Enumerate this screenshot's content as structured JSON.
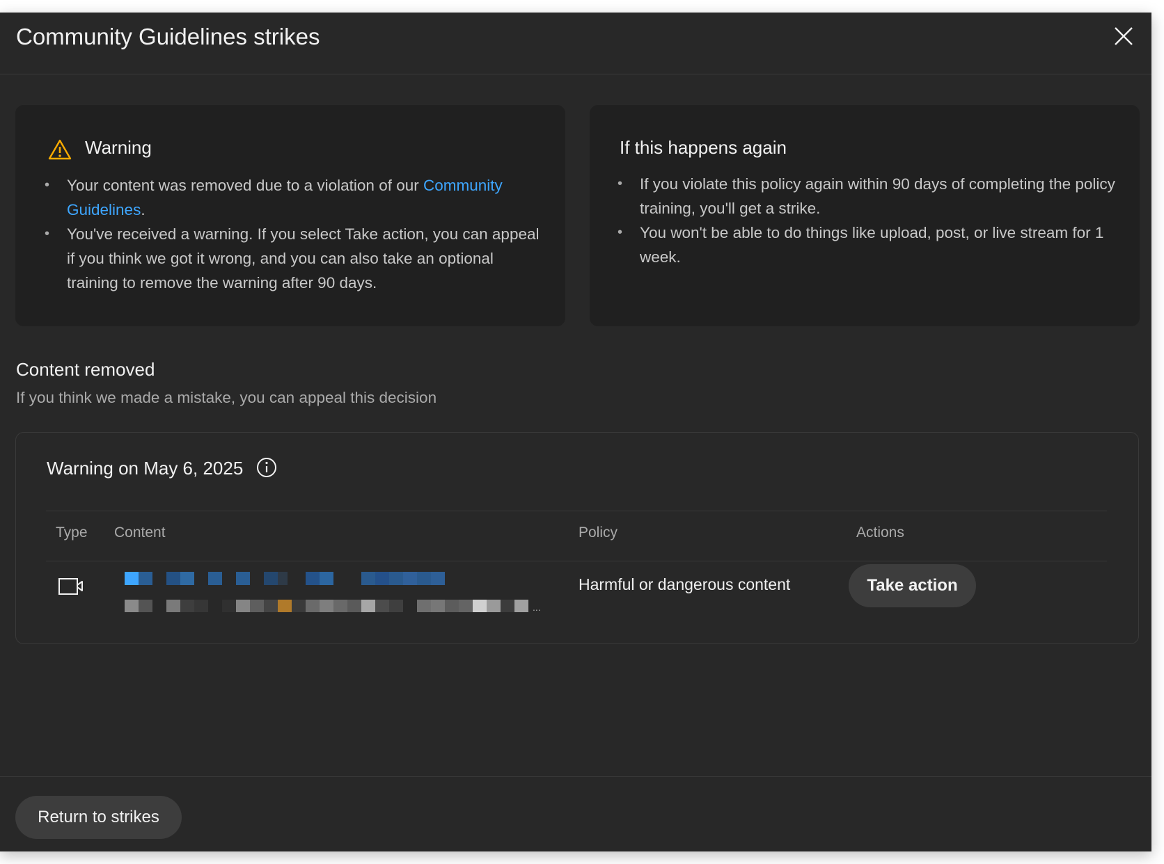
{
  "dialog": {
    "title": "Community Guidelines strikes",
    "close_icon": "close-icon"
  },
  "warning_card": {
    "heading": "Warning",
    "icon": "warning-triangle-icon",
    "bullet1_text": "Your content was removed due to a violation of our ",
    "bullet1_link": "Community Guidelines",
    "bullet1_end": ".",
    "bullet2": "You've received a warning. If you select Take action, you can appeal if you think we got it wrong, and you can also take an optional training to remove the warning after 90 days."
  },
  "again_card": {
    "heading": "If this happens again",
    "bullet1": "If you violate this policy again within 90 days of completing the policy training, you'll get a strike.",
    "bullet2": "You won't be able to do things like upload, post, or live stream for 1 week."
  },
  "content_removed": {
    "title": "Content removed",
    "subtitle": "If you think we made a mistake, you can appeal this decision"
  },
  "warning_panel": {
    "title": "Warning on May 6, 2025",
    "info_icon": "info-icon",
    "columns": [
      "Type",
      "Content",
      "Policy",
      "Actions"
    ],
    "row": {
      "type_icon": "video-icon",
      "content": "redacted",
      "ellipsis": "...",
      "policy": "Harmful or dangerous content",
      "action_label": "Take action"
    }
  },
  "footer": {
    "return_label": "Return to strikes"
  },
  "colors": {
    "background": "#282828",
    "card": "#202020",
    "link": "#3ea6ff",
    "warning_icon": "#f9ab00",
    "button": "#3d3d3d"
  }
}
